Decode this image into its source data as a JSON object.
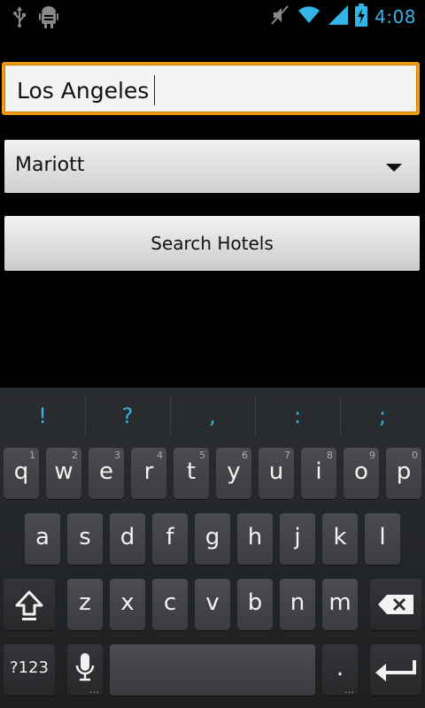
{
  "status_bar": {
    "time": "4:08",
    "icons": [
      "usb-icon",
      "android-debug-icon",
      "mute-icon",
      "wifi-icon",
      "signal-icon",
      "battery-charging-icon"
    ]
  },
  "form": {
    "city_value": "Los Angeles",
    "hotel_selected": "Mariott",
    "search_label": "Search Hotels"
  },
  "keyboard": {
    "suggestions": [
      "!",
      "?",
      ",",
      ":",
      ";"
    ],
    "row1": [
      "q",
      "w",
      "e",
      "r",
      "t",
      "y",
      "u",
      "i",
      "o",
      "p"
    ],
    "row1_hints": [
      "1",
      "2",
      "3",
      "4",
      "5",
      "6",
      "7",
      "8",
      "9",
      "0"
    ],
    "row2": [
      "a",
      "s",
      "d",
      "f",
      "g",
      "h",
      "j",
      "k",
      "l"
    ],
    "row3": [
      "z",
      "x",
      "c",
      "v",
      "b",
      "n",
      "m"
    ],
    "symbols_label": "?123",
    "period_label": ".",
    "mic_label": "…",
    "period_hint": "…"
  },
  "colors": {
    "accent": "#33b5e5",
    "focus_border": "#f39c12",
    "background": "#000000",
    "keyboard_bg": "#242628"
  }
}
